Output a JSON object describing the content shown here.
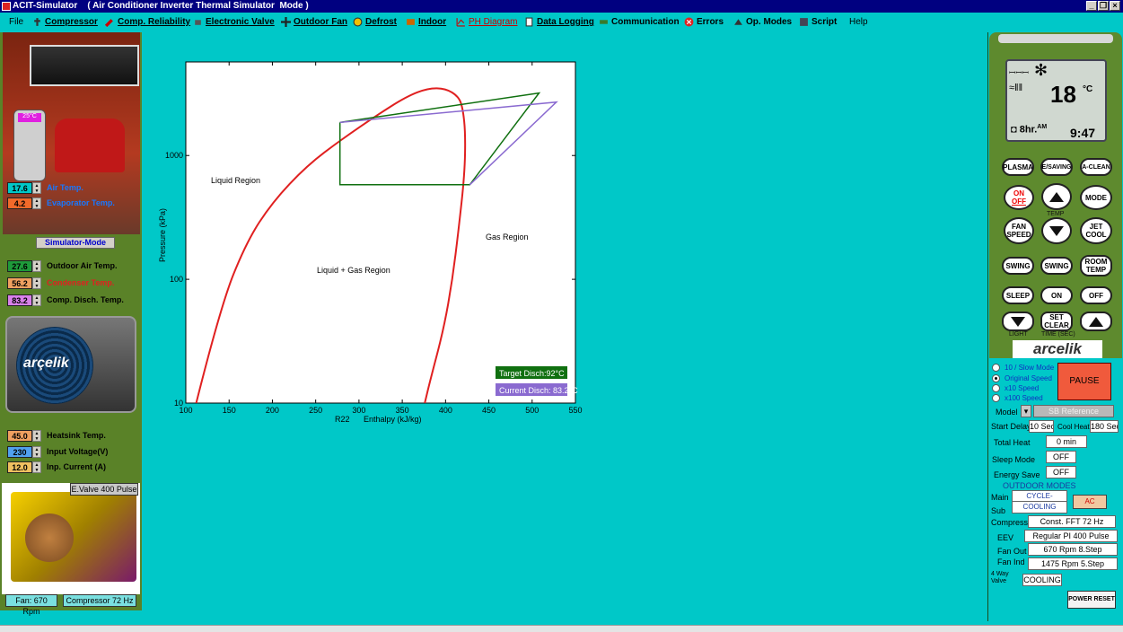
{
  "window": {
    "title": "ACIT-Simulator    ( Air Conditioner Inverter Thermal Simulator  Mode )"
  },
  "menu": [
    {
      "label": "File",
      "icon": "none"
    },
    {
      "label": "Compressor",
      "icon": "compressor-icon"
    },
    {
      "label": "Comp. Reliability",
      "icon": "wrench-icon"
    },
    {
      "label": "Electronic  Valve",
      "icon": "valve-icon"
    },
    {
      "label": "Outdoor Fan",
      "icon": "fan-icon"
    },
    {
      "label": "Defrost",
      "icon": "sun-icon"
    },
    {
      "label": "Indoor",
      "icon": "indoor-icon"
    },
    {
      "label": "PH Diagram",
      "icon": "chart-icon"
    },
    {
      "label": "Data Logging",
      "icon": "log-icon"
    },
    {
      "label": "Communication",
      "icon": "network-icon"
    },
    {
      "label": "Errors",
      "icon": "error-icon"
    },
    {
      "label": "Op. Modes",
      "icon": "modes-icon"
    },
    {
      "label": "Script",
      "icon": "script-icon"
    },
    {
      "label": "Help",
      "icon": "none"
    }
  ],
  "left": {
    "remote_display": "25°C",
    "air_temp": {
      "value": "17.6",
      "label": "Air Temp."
    },
    "evap_temp": {
      "value": "4.2",
      "label": "Evaporator Temp."
    },
    "sim_mode": "Simulator-Mode",
    "outdoor_air": {
      "value": "27.6",
      "label": "Outdoor Air Temp."
    },
    "condenser": {
      "value": "56.2",
      "label": "Condenser Temp."
    },
    "comp_disch": {
      "value": "83.2",
      "label": "Comp. Disch. Temp."
    },
    "brand_outdoor": "arçelik",
    "heatsink": {
      "value": "45.0",
      "label": "Heatsink Temp."
    },
    "input_voltage": {
      "value": "230",
      "label": "Input Voltage(V)"
    },
    "input_current": {
      "value": "12.0",
      "label": "Inp. Current (A)"
    },
    "evalve": "E.Valve 400 Pulse",
    "fan": "Fan: 670 Rpm",
    "compressor": "Compressor 72 Hz"
  },
  "chart_data": {
    "type": "line",
    "xlabel": "Enthalpy (kJ/kg)",
    "ylabel": "Pressure (kPa)",
    "refrigerant": "R22",
    "xlim": [
      100,
      550
    ],
    "ylim": [
      10,
      10000
    ],
    "yscale": "log",
    "plot_ylim": [
      10,
      5700
    ],
    "x_ticks": [
      100,
      150,
      200,
      250,
      300,
      350,
      400,
      450,
      500,
      550
    ],
    "y_ticks": [
      10,
      100,
      1000
    ],
    "annotations": [
      "Liquid Region",
      "Liquid + Gas Region",
      "Gas Region"
    ],
    "series": [
      {
        "name": "saturation",
        "color": "#e02020",
        "points": [
          [
            112,
            10
          ],
          [
            140,
            60
          ],
          [
            170,
            200
          ],
          [
            200,
            420
          ],
          [
            240,
            830
          ],
          [
            280,
            1350
          ],
          [
            320,
            2100
          ],
          [
            355,
            3000
          ],
          [
            380,
            3500
          ],
          [
            400,
            3480
          ],
          [
            415,
            3000
          ],
          [
            420,
            2400
          ],
          [
            423,
            1500
          ],
          [
            422,
            700
          ],
          [
            415,
            250
          ],
          [
            408,
            100
          ],
          [
            398,
            40
          ],
          [
            382,
            15
          ],
          [
            376,
            10
          ]
        ]
      },
      {
        "name": "Target Disch:92°C",
        "color": "#107010",
        "points": [
          [
            278,
            1850
          ],
          [
            508,
            3200
          ],
          [
            428,
            580
          ],
          [
            278,
            580
          ],
          [
            278,
            1850
          ]
        ]
      },
      {
        "name": "Current Disch:  83.2°C",
        "color": "#8a6ad0",
        "points": [
          [
            278,
            1850
          ],
          [
            528,
            2700
          ],
          [
            428,
            580
          ]
        ]
      }
    ],
    "legend": [
      {
        "text": "Target Disch:92°C",
        "color": "#107010"
      },
      {
        "text": "Current Disch:  83.2°C",
        "color": "#8a6ad0"
      }
    ]
  },
  "remote": {
    "set_temp": "18",
    "unit": "°C",
    "timer": "8hr.",
    "am": "AM",
    "clock": "9:47",
    "buttons": {
      "plasma": "PLASMA",
      "esaving": "E/SAVING",
      "aclean": "A-CLEAN",
      "on": "ON",
      "off": "OFF",
      "mode": "MODE",
      "temp": "TEMP",
      "fan": "FAN",
      "speed": "SPEED",
      "jet": "JET",
      "cool": "COOL",
      "swing1": "SWING",
      "swing2": "SWING",
      "room": "ROOM",
      "roomtemp": "TEMP",
      "sleep": "SLEEP",
      "on2": "ON",
      "off2": "OFF",
      "set": "SET",
      "clear": "CLEAR",
      "light": "LIGHT",
      "timesec": "TIME (SEC)"
    },
    "brand": "arcelik"
  },
  "controls": {
    "speeds": [
      "10 / Slow Mode",
      "Original Speed",
      "x10 Speed",
      "x100 Speed"
    ],
    "pause": "PAUSE",
    "model_label": "Model",
    "model_value": "SB Reference",
    "start_delay_label": "Start Delay",
    "start_delay": "10 Sec",
    "cool_heat_label": "Cool Heat",
    "cool_heat": "180 Sec",
    "total_heat_label": "Total Heat",
    "total_heat": "0 min",
    "sleep_label": "Sleep Mode",
    "sleep": "OFF",
    "energy_label": "Energy Save",
    "energy": "OFF",
    "outdoor_modes": "OUTDOOR MODES",
    "main_label": "Main",
    "main": "CYCLE-",
    "sub_label": "Sub",
    "sub": "COOLING",
    "ac": "AC",
    "compress_label": "Compress",
    "compress": "Const.  FFT  72 Hz",
    "eev_label": "EEV",
    "eev": "Regular PI    400 Pulse",
    "fanout_label": "Fan Out",
    "fanout": "670 Rpm  8.Step",
    "fanind_label": "Fan Ind",
    "fanind": "1475 Rpm  5.Step",
    "valve_label1": "4 Way",
    "valve_label2": "Valve",
    "valve": "COOLING",
    "reset": "POWER RESET"
  }
}
